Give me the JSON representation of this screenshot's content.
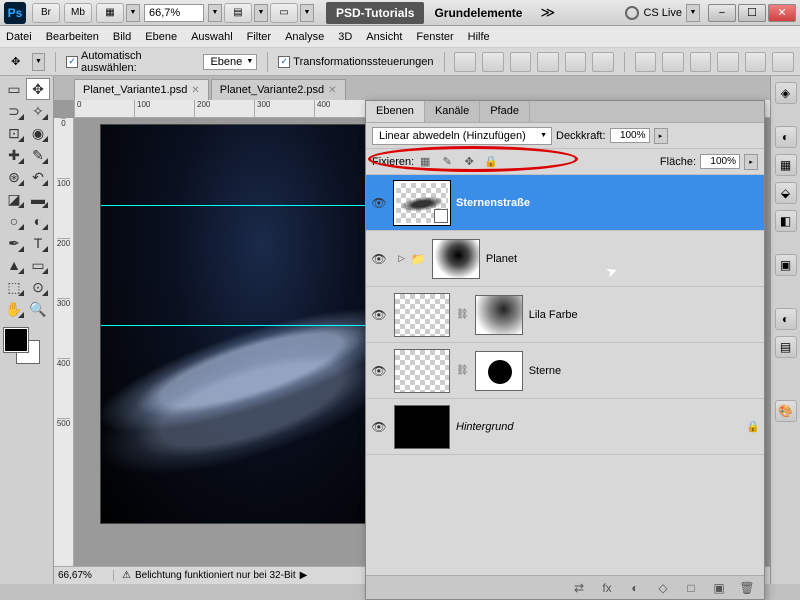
{
  "titlebar": {
    "ps": "Ps",
    "br": "Br",
    "mb": "Mb",
    "zoom": "66,7",
    "pct": "%",
    "ws1": "PSD-Tutorials",
    "ws2": "Grundelemente",
    "cslive": "CS Live"
  },
  "menu": {
    "items": [
      "Datei",
      "Bearbeiten",
      "Bild",
      "Ebene",
      "Auswahl",
      "Filter",
      "Analyse",
      "3D",
      "Ansicht",
      "Fenster",
      "Hilfe"
    ]
  },
  "options": {
    "auto_select": "Automatisch auswählen:",
    "auto_target": "Ebene",
    "transform": "Transformationssteuerungen"
  },
  "docs": {
    "tabs": [
      "Planet_Variante1.psd",
      "Planet_Variante2.psd"
    ]
  },
  "ruler_h": [
    "0",
    "100",
    "200",
    "300",
    "400"
  ],
  "ruler_v": [
    "0",
    "100",
    "200",
    "300",
    "400",
    "500"
  ],
  "status": {
    "zoom": "66,67%",
    "msg": "Belichtung funktioniert nur bei 32-Bit"
  },
  "panel": {
    "tabs": [
      "Ebenen",
      "Kanäle",
      "Pfade"
    ],
    "blend_mode": "Linear abwedeln (Hinzufügen)",
    "opacity_label": "Deckkraft:",
    "opacity_val": "100%",
    "lock_label": "Fixieren:",
    "fill_label": "Fläche:",
    "fill_val": "100%",
    "layers": [
      {
        "name": "Sternenstraße",
        "selected": true
      },
      {
        "name": "Planet",
        "group": true
      },
      {
        "name": "Lila Farbe"
      },
      {
        "name": "Sterne"
      },
      {
        "name": "Hintergrund",
        "locked": true
      }
    ],
    "footer_icons": [
      "⇄",
      "fx",
      "◐",
      "◇",
      "□",
      "▣",
      "🗑"
    ]
  }
}
